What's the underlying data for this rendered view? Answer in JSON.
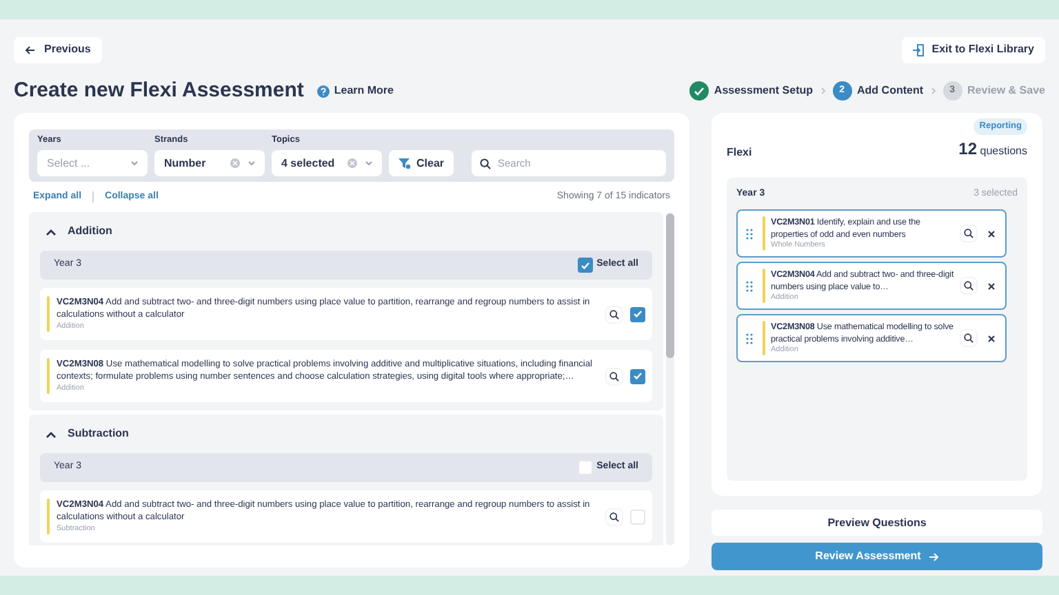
{
  "previous_button": "Previous",
  "exit_button": "Exit to Flexi Library",
  "title": "Create new Flexi Assessment",
  "learn_more": "Learn More",
  "steps": [
    {
      "label": "Assessment Setup",
      "kind": "done"
    },
    {
      "number": "2",
      "label": "Add Content",
      "kind": "current"
    },
    {
      "number": "3",
      "label": "Review & Save",
      "kind": "upcoming"
    }
  ],
  "filters": [
    {
      "label": "Years",
      "value": "Select ...",
      "clearable": false
    },
    {
      "label": "Strands",
      "value": "Number",
      "clearable": true
    },
    {
      "label": "Topics",
      "value": "4 selected",
      "clearable": true
    }
  ],
  "clear_button": "Clear",
  "search": {
    "placeholder": "Search"
  },
  "expand_all": "Expand all",
  "collapse_all": "Collapse all",
  "showing": "Showing 7 of 15 indicators",
  "sections": [
    {
      "title": "Addition",
      "expanded": true,
      "year": "Year 3",
      "select_all": "Select all",
      "all_checked": true,
      "items": [
        {
          "text": "**VC2M3N04** Add and subtract two- and three-digit numbers using place value to partition, rearrange and regroup numbers to assist in calculations without a calculator",
          "topic": "Addition",
          "checked": true
        },
        {
          "text": "**VC2M3N08** Use mathematical modelling to solve practical problems involving additive and multiplicative situations, including financial contexts; formulate problems using number sentences and choose calculation strategies, using digital tools where appropriate;…",
          "topic": "Addition",
          "checked": true
        }
      ]
    },
    {
      "title": "Subtraction",
      "expanded": true,
      "year": "Year 3",
      "select_all": "Select all",
      "all_checked": false,
      "items": [
        {
          "text": "**VC2M3N04** Add and subtract two- and three-digit numbers using place value to partition, rearrange and regroup numbers to assist in calculations without a calculator",
          "topic": "Subtraction",
          "checked": false
        }
      ]
    }
  ],
  "flexi": {
    "title": "Flexi",
    "badge": "Reporting",
    "count": "12",
    "count_label": "questions",
    "year": "Year 3",
    "selected_count": "3 selected",
    "items": [
      {
        "text": "**VC2M3N01** Identify, explain and use the properties of odd and even numbers",
        "topic": "Whole Numbers"
      },
      {
        "text": "**VC2M3N04** Add and subtract two- and three-digit numbers using place value to…",
        "topic": "Addition"
      },
      {
        "text": "**VC2M3N08** Use mathematical modelling to solve practical problems involving additive…",
        "topic": "Addition"
      }
    ]
  },
  "preview_button": "Preview Questions",
  "review_button": "Review Assessment"
}
